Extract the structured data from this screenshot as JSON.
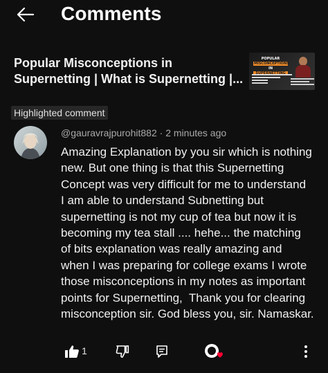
{
  "header": {
    "title": "Comments",
    "back_icon": "arrow-left-icon"
  },
  "video": {
    "title_lines": [
      "Popular Misconceptions in",
      "Supernetting | What is Supernetting |..."
    ],
    "thumbnail": {
      "title_top": "POPULAR",
      "title_box1": "MISCONCEPTIONS",
      "title_mid": "IN",
      "title_box2": "SUPERNETTING"
    }
  },
  "badge": {
    "label": "Highlighted comment"
  },
  "comment": {
    "author": "@gauravrajpurohit882",
    "separator": " · ",
    "time": "2 minutes ago",
    "lines": [
      "Amazing Explanation by you sir which is nothing",
      "new. But one thing is that this Supernetting",
      "Concept was very difficult for me to understand",
      "I am able to understand Subnetting but",
      "supernetting is not my cup of tea but now it is",
      "becoming my tea stall .... hehe... the matching",
      "of bits explanation was really amazing and",
      "when I was preparing for college exams I wrote",
      "those misconceptions in my notes as important",
      "points for Supernetting,  Thank you for clearing",
      "misconception sir. God bless you, sir. Namaskar."
    ]
  },
  "actions": {
    "like_count": "1",
    "icons": [
      "thumbs-up-icon",
      "thumbs-down-icon",
      "reply-icon",
      "creator-heart-icon",
      "more-vert-icon"
    ],
    "heart_color": "#ff0033"
  }
}
